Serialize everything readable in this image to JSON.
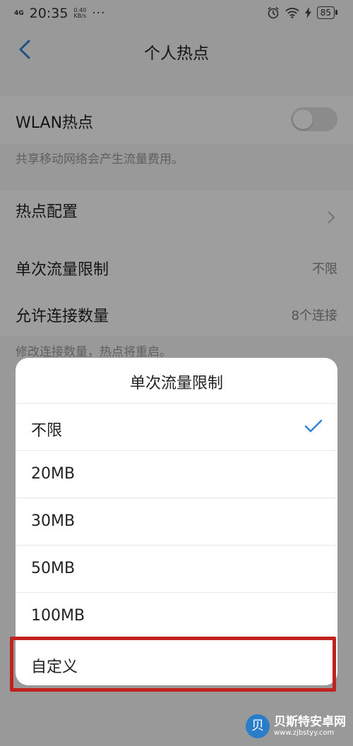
{
  "status": {
    "signal": "4G",
    "time": "20:35",
    "speed_value": "0.40",
    "speed_unit": "KB/s",
    "more": "···",
    "battery": "85"
  },
  "header": {
    "title": "个人热点"
  },
  "wlan": {
    "label": "WLAN热点",
    "enabled": false,
    "note": "共享移动网络会产生流量费用。"
  },
  "config": {
    "label": "热点配置"
  },
  "limit": {
    "label": "单次流量限制",
    "value": "不限"
  },
  "connections": {
    "label": "允许连接数量",
    "value": "8个连接",
    "note": "修改连接数量，热点将重启。"
  },
  "sheet": {
    "title": "单次流量限制",
    "options": [
      {
        "label": "不限",
        "selected": true
      },
      {
        "label": "20MB",
        "selected": false
      },
      {
        "label": "30MB",
        "selected": false
      },
      {
        "label": "50MB",
        "selected": false
      },
      {
        "label": "100MB",
        "selected": false
      },
      {
        "label": "自定义",
        "selected": false
      }
    ]
  },
  "colors": {
    "accent": "#2f86d6",
    "highlight": "#c0231e"
  },
  "watermark": {
    "name": "贝斯特安卓网",
    "url": "www.zjbstyy.com"
  }
}
